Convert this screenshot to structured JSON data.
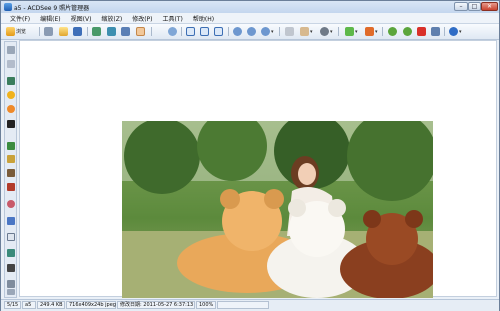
{
  "window": {
    "title": "a5 - ACDSee 9 照片管理器"
  },
  "window_controls": {
    "minimize": "–",
    "maximize": "□",
    "close": "✕"
  },
  "menu": [
    "文件(F)",
    "编辑(E)",
    "视图(V)",
    "缩放(Z)",
    "修改(P)",
    "工具(T)",
    "帮助(H)"
  ],
  "toolbar": {
    "browse_label": "浏览"
  },
  "status": {
    "position": "5/15",
    "name": "a5",
    "size": "249.4 KB",
    "info": "716x409x24b jpeg",
    "date": "修改日期: 2011-05-27 6:37:13",
    "zoom": "100%"
  },
  "photo": {
    "description_icon": "image"
  }
}
